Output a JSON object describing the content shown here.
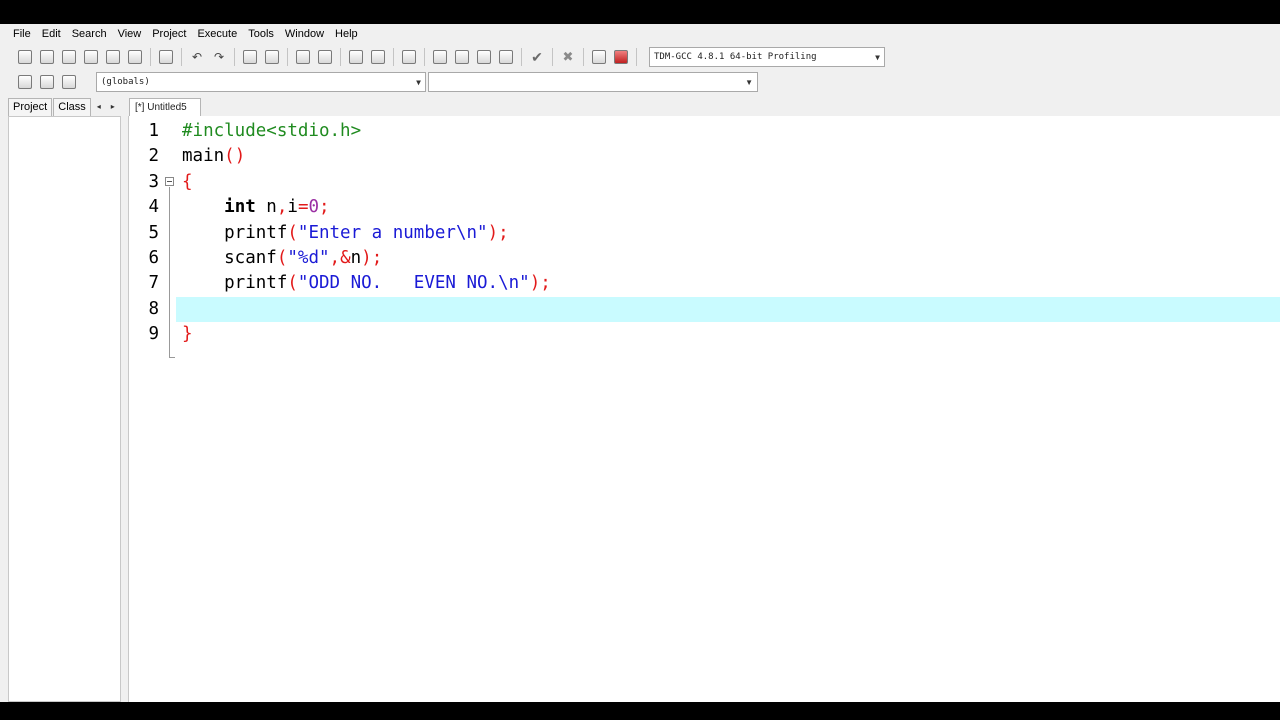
{
  "menu": [
    "File",
    "Edit",
    "Search",
    "View",
    "Project",
    "Execute",
    "Tools",
    "Window",
    "Help"
  ],
  "toolbar": {
    "compiler": "TDM-GCC 4.8.1 64-bit Profiling"
  },
  "scope": {
    "value": "(globals)"
  },
  "left_panel": {
    "tabs": [
      "Project",
      "Class"
    ]
  },
  "editor": {
    "tab_label": "[*] Untitled5",
    "active_line": 8,
    "lines": [
      {
        "n": "1",
        "tokens": [
          {
            "t": "pre",
            "v": "#include<stdio.h>"
          }
        ]
      },
      {
        "n": "2",
        "tokens": [
          {
            "t": "id",
            "v": "main"
          },
          {
            "t": "br",
            "v": "()"
          }
        ]
      },
      {
        "n": "3",
        "tokens": [
          {
            "t": "br",
            "v": "{"
          }
        ]
      },
      {
        "n": "4",
        "tokens": [
          {
            "t": "id",
            "v": "    "
          },
          {
            "t": "kw",
            "v": "int"
          },
          {
            "t": "id",
            "v": " n"
          },
          {
            "t": "br",
            "v": ","
          },
          {
            "t": "id",
            "v": "i"
          },
          {
            "t": "br",
            "v": "="
          },
          {
            "t": "num",
            "v": "0"
          },
          {
            "t": "br",
            "v": ";"
          }
        ]
      },
      {
        "n": "5",
        "tokens": [
          {
            "t": "id",
            "v": "    printf"
          },
          {
            "t": "br",
            "v": "("
          },
          {
            "t": "str",
            "v": "\"Enter a number\\n\""
          },
          {
            "t": "br",
            "v": ");"
          }
        ]
      },
      {
        "n": "6",
        "tokens": [
          {
            "t": "id",
            "v": "    scanf"
          },
          {
            "t": "br",
            "v": "("
          },
          {
            "t": "str",
            "v": "\"%d\""
          },
          {
            "t": "br",
            "v": ",&"
          },
          {
            "t": "id",
            "v": "n"
          },
          {
            "t": "br",
            "v": ");"
          }
        ]
      },
      {
        "n": "7",
        "tokens": [
          {
            "t": "id",
            "v": "    printf"
          },
          {
            "t": "br",
            "v": "("
          },
          {
            "t": "str",
            "v": "\"ODD NO.   EVEN NO.\\n\""
          },
          {
            "t": "br",
            "v": ");"
          }
        ]
      },
      {
        "n": "8",
        "tokens": []
      },
      {
        "n": "9",
        "tokens": [
          {
            "t": "br",
            "v": "}"
          }
        ]
      }
    ]
  }
}
